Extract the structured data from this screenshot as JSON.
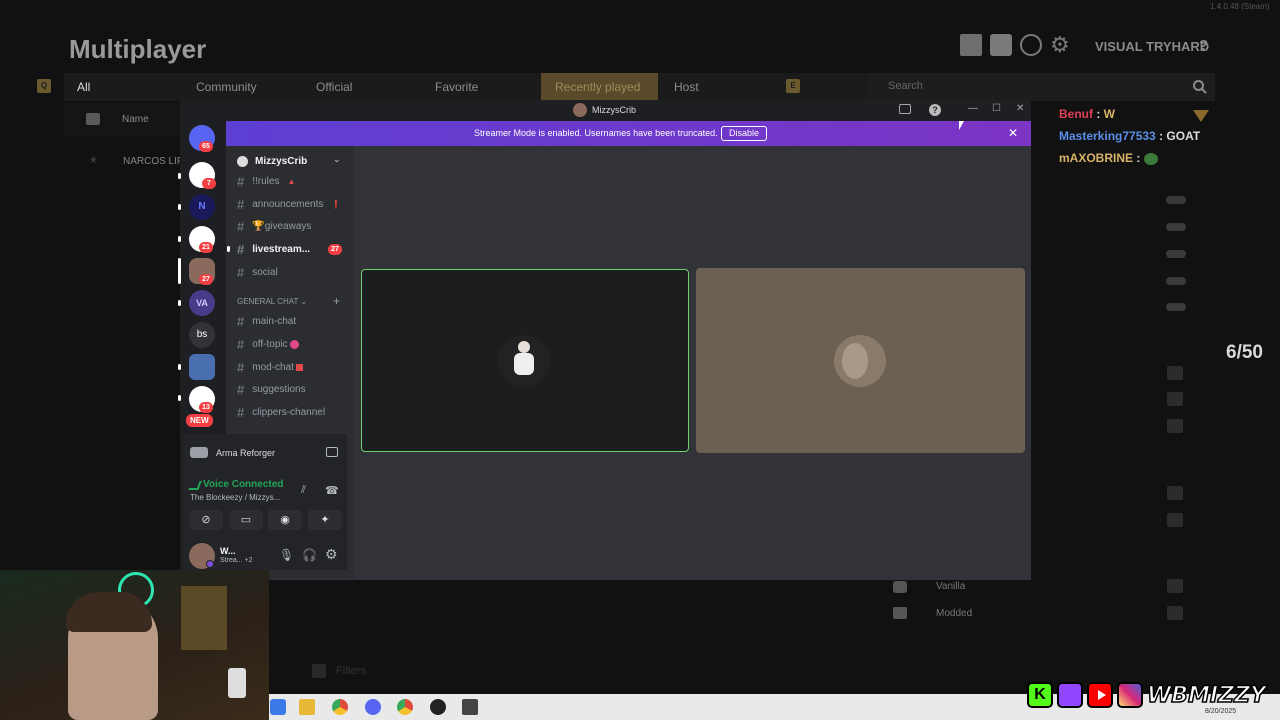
{
  "game": {
    "title": "Multiplayer",
    "profile_name": "VISUAL TRYHARD",
    "help": "?",
    "version": "1.4.0.48 (Steam)",
    "tabs": [
      "All",
      "Community",
      "Official",
      "Favorite",
      "Recently played",
      "Host"
    ],
    "active_tab": "Recently played",
    "key_left": "Q",
    "key_right": "E",
    "search_placeholder": "Search",
    "column_name": "Name",
    "row_server": "NARCOS LIFE",
    "filters": [
      "Vanilla",
      "Modded"
    ],
    "filters_label": "Filters",
    "counter": "6/50"
  },
  "chat": [
    {
      "user": "Benuf",
      "msg": "W",
      "color": "#e0415a"
    },
    {
      "user": "Masterking77533",
      "msg": "GOAT",
      "color": "#5b8fe8"
    },
    {
      "user": "mAXOBRINE",
      "msg": "",
      "color": "#d8b36a"
    }
  ],
  "discord": {
    "window_title": "MizzysCrib",
    "banner_text": "Streamer Mode is enabled. Usernames have been truncated.",
    "banner_button": "Disable",
    "server_name": "MizzysCrib",
    "servers": [
      {
        "label": "",
        "badge": "65",
        "color": "#5865f2"
      },
      {
        "label": "",
        "badge": "7",
        "color": "#ffffff"
      },
      {
        "label": "N",
        "badge": "",
        "color": "#1a1a5a"
      },
      {
        "label": "",
        "badge": "21",
        "color": "#ffffff"
      },
      {
        "label": "",
        "badge": "27",
        "color": "#8a6a5c"
      },
      {
        "label": "VA",
        "badge": "",
        "color": "#4a3a8a"
      },
      {
        "label": "bs",
        "badge": "",
        "color": "#313338"
      },
      {
        "label": "",
        "badge": "",
        "color": "#4a6fb0"
      },
      {
        "label": "",
        "badge": "13",
        "color": "#ffffff"
      }
    ],
    "new_label": "NEW",
    "channels_top": [
      {
        "name": "!!rules",
        "active": false
      },
      {
        "name": "announcements",
        "active": false
      },
      {
        "name": "giveaways",
        "active": false
      },
      {
        "name": "livestream...",
        "active": true,
        "badge": "27"
      },
      {
        "name": "social",
        "active": false
      }
    ],
    "category": "GENERAL CHAT",
    "channels_general": [
      {
        "name": "main-chat"
      },
      {
        "name": "off-topic"
      },
      {
        "name": "mod-chat"
      },
      {
        "name": "suggestions"
      },
      {
        "name": "clippers-channel"
      }
    ],
    "activity_game": "Arma Reforger",
    "voice_status": "Voice Connected",
    "voice_location": "The Blockeezy / Mizzys...",
    "user_name": "W...",
    "user_status": "Strea...",
    "user_extra": "+2"
  },
  "taskbar": {
    "date": "8/20/2025"
  },
  "socials": {
    "handle": "WBMIZZY",
    "platforms": [
      "kick-icon",
      "twitch-icon",
      "youtube-icon",
      "instagram-icon"
    ],
    "colors": {
      "kick": "#53fc18",
      "twitch": "#9146ff",
      "youtube": "#ff0000",
      "instagram": "#d62976"
    }
  }
}
